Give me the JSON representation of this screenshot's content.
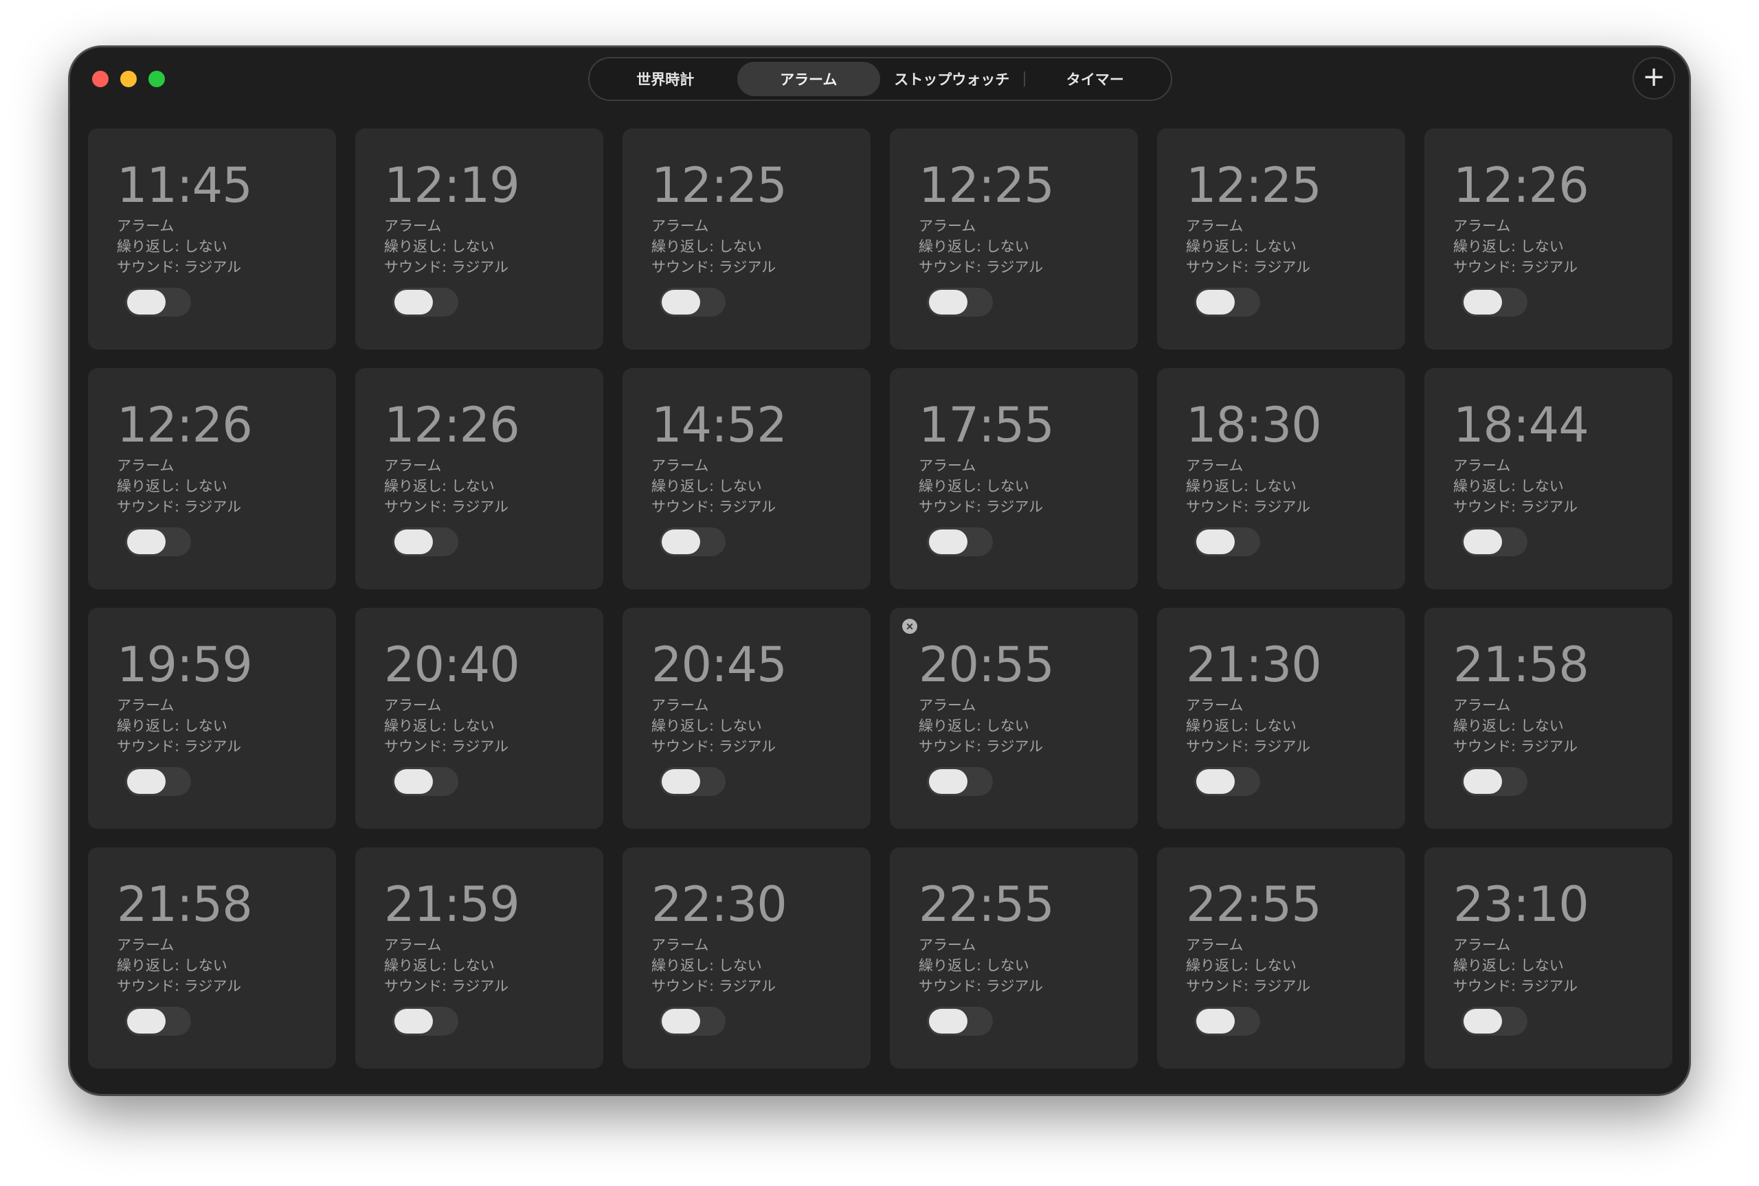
{
  "window": {
    "tabs": [
      {
        "label": "世界時計"
      },
      {
        "label": "アラーム"
      },
      {
        "label": "ストップウォッチ"
      },
      {
        "label": "タイマー"
      }
    ],
    "active_tab": 1,
    "add_button_label": "+"
  },
  "delete_icon_glyph": "×",
  "alarms": [
    {
      "time": "11:45",
      "name": "アラーム",
      "repeat": "繰り返し: しない",
      "sound": "サウンド: ラジアル",
      "enabled": false
    },
    {
      "time": "12:19",
      "name": "アラーム",
      "repeat": "繰り返し: しない",
      "sound": "サウンド: ラジアル",
      "enabled": false
    },
    {
      "time": "12:25",
      "name": "アラーム",
      "repeat": "繰り返し: しない",
      "sound": "サウンド: ラジアル",
      "enabled": false
    },
    {
      "time": "12:25",
      "name": "アラーム",
      "repeat": "繰り返し: しない",
      "sound": "サウンド: ラジアル",
      "enabled": false
    },
    {
      "time": "12:25",
      "name": "アラーム",
      "repeat": "繰り返し: しない",
      "sound": "サウンド: ラジアル",
      "enabled": false
    },
    {
      "time": "12:26",
      "name": "アラーム",
      "repeat": "繰り返し: しない",
      "sound": "サウンド: ラジアル",
      "enabled": false
    },
    {
      "time": "12:26",
      "name": "アラーム",
      "repeat": "繰り返し: しない",
      "sound": "サウンド: ラジアル",
      "enabled": false
    },
    {
      "time": "12:26",
      "name": "アラーム",
      "repeat": "繰り返し: しない",
      "sound": "サウンド: ラジアル",
      "enabled": false
    },
    {
      "time": "14:52",
      "name": "アラーム",
      "repeat": "繰り返し: しない",
      "sound": "サウンド: ラジアル",
      "enabled": false
    },
    {
      "time": "17:55",
      "name": "アラーム",
      "repeat": "繰り返し: しない",
      "sound": "サウンド: ラジアル",
      "enabled": false
    },
    {
      "time": "18:30",
      "name": "アラーム",
      "repeat": "繰り返し: しない",
      "sound": "サウンド: ラジアル",
      "enabled": false
    },
    {
      "time": "18:44",
      "name": "アラーム",
      "repeat": "繰り返し: しない",
      "sound": "サウンド: ラジアル",
      "enabled": false
    },
    {
      "time": "19:59",
      "name": "アラーム",
      "repeat": "繰り返し: しない",
      "sound": "サウンド: ラジアル",
      "enabled": false
    },
    {
      "time": "20:40",
      "name": "アラーム",
      "repeat": "繰り返し: しない",
      "sound": "サウンド: ラジアル",
      "enabled": false
    },
    {
      "time": "20:45",
      "name": "アラーム",
      "repeat": "繰り返し: しない",
      "sound": "サウンド: ラジアル",
      "enabled": false
    },
    {
      "time": "20:55",
      "name": "アラーム",
      "repeat": "繰り返し: しない",
      "sound": "サウンド: ラジアル",
      "enabled": false,
      "hover_delete": true
    },
    {
      "time": "21:30",
      "name": "アラーム",
      "repeat": "繰り返し: しない",
      "sound": "サウンド: ラジアル",
      "enabled": false
    },
    {
      "time": "21:58",
      "name": "アラーム",
      "repeat": "繰り返し: しない",
      "sound": "サウンド: ラジアル",
      "enabled": false
    },
    {
      "time": "21:58",
      "name": "アラーム",
      "repeat": "繰り返し: しない",
      "sound": "サウンド: ラジアル",
      "enabled": false
    },
    {
      "time": "21:59",
      "name": "アラーム",
      "repeat": "繰り返し: しない",
      "sound": "サウンド: ラジアル",
      "enabled": false
    },
    {
      "time": "22:30",
      "name": "アラーム",
      "repeat": "繰り返し: しない",
      "sound": "サウンド: ラジアル",
      "enabled": false
    },
    {
      "time": "22:55",
      "name": "アラーム",
      "repeat": "繰り返し: しない",
      "sound": "サウンド: ラジアル",
      "enabled": false
    },
    {
      "time": "22:55",
      "name": "アラーム",
      "repeat": "繰り返し: しない",
      "sound": "サウンド: ラジアル",
      "enabled": false
    },
    {
      "time": "23:10",
      "name": "アラーム",
      "repeat": "繰り返し: しない",
      "sound": "サウンド: ラジアル",
      "enabled": false
    }
  ]
}
